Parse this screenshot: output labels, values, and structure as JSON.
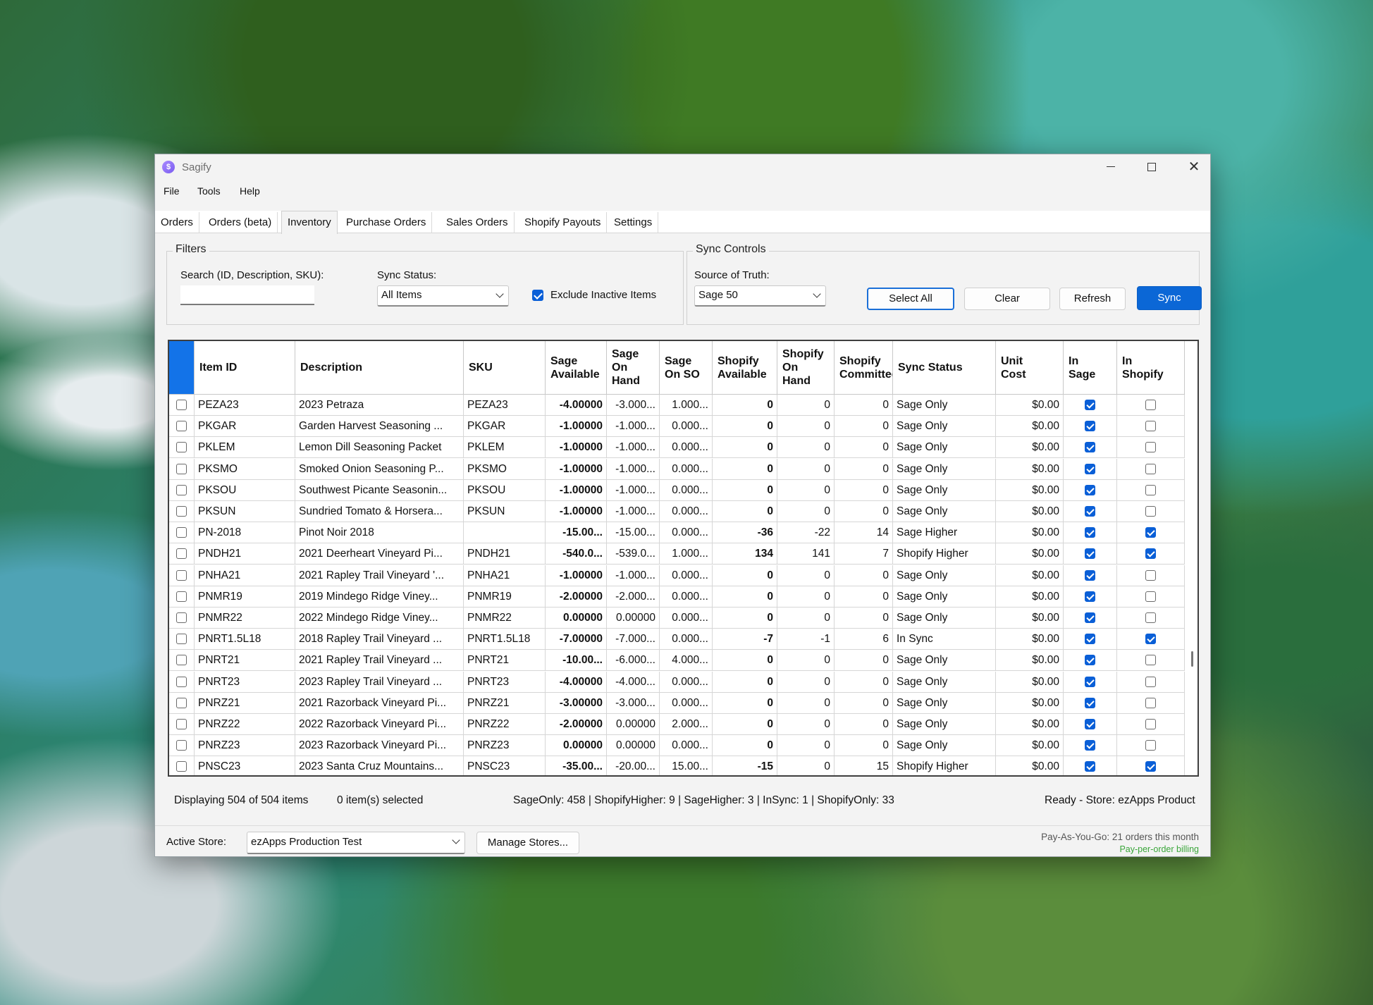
{
  "window": {
    "title": "Sagify"
  },
  "menu": {
    "items": [
      "File",
      "Tools",
      "Help"
    ]
  },
  "tabs": [
    "Orders",
    "Orders (beta)",
    "Inventory",
    "Purchase Orders",
    "Sales Orders",
    "Shopify Payouts",
    "Settings"
  ],
  "active_tab": "Inventory",
  "filters": {
    "title": "Filters",
    "search_label": "Search (ID, Description, SKU):",
    "search_value": "",
    "sync_status_label": "Sync Status:",
    "sync_status_value": "All Items",
    "exclude_inactive_label": "Exclude Inactive Items",
    "exclude_inactive_checked": true
  },
  "sync_controls": {
    "title": "Sync Controls",
    "source_label": "Source of Truth:",
    "source_value": "Sage 50",
    "select_all_label": "Select All",
    "clear_label": "Clear",
    "refresh_label": "Refresh",
    "sync_label": "Sync"
  },
  "table": {
    "columns": [
      "",
      "Item ID",
      "Description",
      "SKU",
      "Sage\nAvailable",
      "Sage\nOn\nHand",
      "Sage\nOn SO",
      "Shopify\nAvailable",
      "Shopify\nOn\nHand",
      "Shopify\nCommitted",
      "Sync Status",
      "Unit\nCost",
      "In\nSage",
      "In\nShopify"
    ],
    "rows": [
      [
        "PEZA23",
        "2023 Petraza",
        "PEZA23",
        "-4.00000",
        "-3.000...",
        "1.000...",
        "0",
        "0",
        "0",
        "Sage Only",
        "$0.00",
        true,
        false
      ],
      [
        "PKGAR",
        "Garden Harvest Seasoning ...",
        "PKGAR",
        "-1.00000",
        "-1.000...",
        "0.000...",
        "0",
        "0",
        "0",
        "Sage Only",
        "$0.00",
        true,
        false
      ],
      [
        "PKLEM",
        "Lemon Dill Seasoning Packet",
        "PKLEM",
        "-1.00000",
        "-1.000...",
        "0.000...",
        "0",
        "0",
        "0",
        "Sage Only",
        "$0.00",
        true,
        false
      ],
      [
        "PKSMO",
        "Smoked Onion Seasoning P...",
        "PKSMO",
        "-1.00000",
        "-1.000...",
        "0.000...",
        "0",
        "0",
        "0",
        "Sage Only",
        "$0.00",
        true,
        false
      ],
      [
        "PKSOU",
        "Southwest Picante Seasonin...",
        "PKSOU",
        "-1.00000",
        "-1.000...",
        "0.000...",
        "0",
        "0",
        "0",
        "Sage Only",
        "$0.00",
        true,
        false
      ],
      [
        "PKSUN",
        "Sundried Tomato & Horsera...",
        "PKSUN",
        "-1.00000",
        "-1.000...",
        "0.000...",
        "0",
        "0",
        "0",
        "Sage Only",
        "$0.00",
        true,
        false
      ],
      [
        "PN-2018",
        "Pinot Noir 2018",
        "",
        "-15.00...",
        "-15.00...",
        "0.000...",
        "-36",
        "-22",
        "14",
        "Sage Higher",
        "$0.00",
        true,
        true
      ],
      [
        "PNDH21",
        "2021 Deerheart Vineyard Pi...",
        "PNDH21",
        "-540.0...",
        "-539.0...",
        "1.000...",
        "134",
        "141",
        "7",
        "Shopify Higher",
        "$0.00",
        true,
        true
      ],
      [
        "PNHA21",
        "2021 Rapley Trail Vineyard '...",
        "PNHA21",
        "-1.00000",
        "-1.000...",
        "0.000...",
        "0",
        "0",
        "0",
        "Sage Only",
        "$0.00",
        true,
        false
      ],
      [
        "PNMR19",
        "2019 Mindego Ridge Viney...",
        "PNMR19",
        "-2.00000",
        "-2.000...",
        "0.000...",
        "0",
        "0",
        "0",
        "Sage Only",
        "$0.00",
        true,
        false
      ],
      [
        "PNMR22",
        "2022 Mindego Ridge Viney...",
        "PNMR22",
        "0.00000",
        "0.00000",
        "0.000...",
        "0",
        "0",
        "0",
        "Sage Only",
        "$0.00",
        true,
        false
      ],
      [
        "PNRT1.5L18",
        "2018 Rapley Trail Vineyard ...",
        "PNRT1.5L18",
        "-7.00000",
        "-7.000...",
        "0.000...",
        "-7",
        "-1",
        "6",
        "In Sync",
        "$0.00",
        true,
        true
      ],
      [
        "PNRT21",
        "2021 Rapley Trail Vineyard ...",
        "PNRT21",
        "-10.00...",
        "-6.000...",
        "4.000...",
        "0",
        "0",
        "0",
        "Sage Only",
        "$0.00",
        true,
        false
      ],
      [
        "PNRT23",
        "2023 Rapley Trail Vineyard ...",
        "PNRT23",
        "-4.00000",
        "-4.000...",
        "0.000...",
        "0",
        "0",
        "0",
        "Sage Only",
        "$0.00",
        true,
        false
      ],
      [
        "PNRZ21",
        "2021 Razorback Vineyard Pi...",
        "PNRZ21",
        "-3.00000",
        "-3.000...",
        "0.000...",
        "0",
        "0",
        "0",
        "Sage Only",
        "$0.00",
        true,
        false
      ],
      [
        "PNRZ22",
        "2022 Razorback Vineyard Pi...",
        "PNRZ22",
        "-2.00000",
        "0.00000",
        "2.000...",
        "0",
        "0",
        "0",
        "Sage Only",
        "$0.00",
        true,
        false
      ],
      [
        "PNRZ23",
        "2023 Razorback Vineyard Pi...",
        "PNRZ23",
        "0.00000",
        "0.00000",
        "0.000...",
        "0",
        "0",
        "0",
        "Sage Only",
        "$0.00",
        true,
        false
      ],
      [
        "PNSC23",
        "2023 Santa Cruz Mountains...",
        "PNSC23",
        "-35.00...",
        "-20.00...",
        "15.00...",
        "-15",
        "0",
        "15",
        "Shopify Higher",
        "$0.00",
        true,
        true
      ]
    ]
  },
  "status": {
    "displaying": "Displaying 504 of 504 items",
    "selected": "0 item(s) selected",
    "summary": "SageOnly: 458 | ShopifyHigher: 9 | SageHigher: 3 | InSync: 1 | ShopifyOnly: 33",
    "ready": "Ready - Store: ezApps Product"
  },
  "bottom": {
    "active_store_label": "Active Store:",
    "active_store_value": "ezApps Production Test",
    "manage_stores_label": "Manage Stores...",
    "billing_text": "Pay-As-You-Go: 21 orders this month",
    "billing_sub": "Pay-per-order billing"
  },
  "colors": {
    "accent": "#0b67d6",
    "billing_green": "#3aa63a"
  }
}
